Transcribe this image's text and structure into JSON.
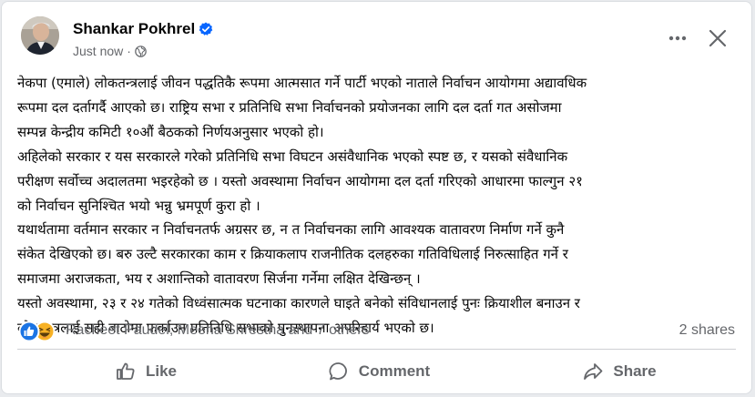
{
  "post": {
    "author": "Shankar Pokhrel",
    "verified": true,
    "timestamp": "Just now",
    "separator": "·",
    "audience_icon": "globe-icon",
    "lines": [
      "नेकपा (एमाले) लोकतन्त्रलाई जीवन पद्धतिकै रूपमा आत्मसात गर्ने पार्टी भएको नाताले निर्वाचन आयोगमा अद्यावधिक",
      "रूपमा दल दर्तागर्दै आएको छ। राष्ट्रिय सभा र प्रतिनिधि सभा निर्वाचनको प्रयोजनका लागि दल दर्ता गत असोजमा",
      "सम्पन्न केन्द्रीय कमिटी १०औं बैठकको निर्णयअनुसार भएको हो।",
      "अहिलेको सरकार र यस सरकारले गरेको प्रतिनिधि सभा विघटन असंवैधानिक भएको स्पष्ट छ, र यसको संवैधानिक",
      "परीक्षण सर्वोच्च अदालतमा भइरहेको छ । यस्तो अवस्थामा निर्वाचन आयोगमा दल दर्ता गरिएको आधारमा फाल्गुन २१",
      "को निर्वाचन सुनिश्चित भयो भन्नु भ्रमपूर्ण कुरा हो ।",
      "यथार्थतामा वर्तमान सरकार न निर्वाचनतर्फ अग्रसर छ, न त निर्वाचनका लागि आवश्यक वातावरण निर्माण गर्ने कुनै",
      "संकेत देखिएको छ। बरु उल्टै सरकारका काम र क्रियाकलाप राजनीतिक दलहरुका गतिविधिलाई निरुत्साहित गर्ने र",
      "समाजमा अराजकता, भय र अशान्तिको वातावरण सिर्जना गर्नेमा लक्षित देखिन्छन् ।",
      "यस्तो अवस्थामा, २३ र २४ गतेको विध्वंसात्मक घटनाका कारणले घाइते बनेको संविधानलाई पुनः क्रियाशील बनाउन र",
      "लोकतन्त्रलाई सही बाटोमा फर्काउन प्रतिनिधि सभाको पुनस्थापना अपरिहार्य भएको छ।"
    ]
  },
  "reactions": {
    "icons": [
      "like-reaction-icon",
      "haha-reaction-icon"
    ],
    "names": "Racheet Paudel, Meena Shrestha and 7 others",
    "shares": "2 shares"
  },
  "actions": {
    "like": "Like",
    "comment": "Comment",
    "share": "Share"
  },
  "colors": {
    "text": "#050505",
    "secondary": "#65676b",
    "verified": "#0866ff",
    "like_blue": "#1b74e4",
    "haha_yellow": "#f7b125"
  }
}
